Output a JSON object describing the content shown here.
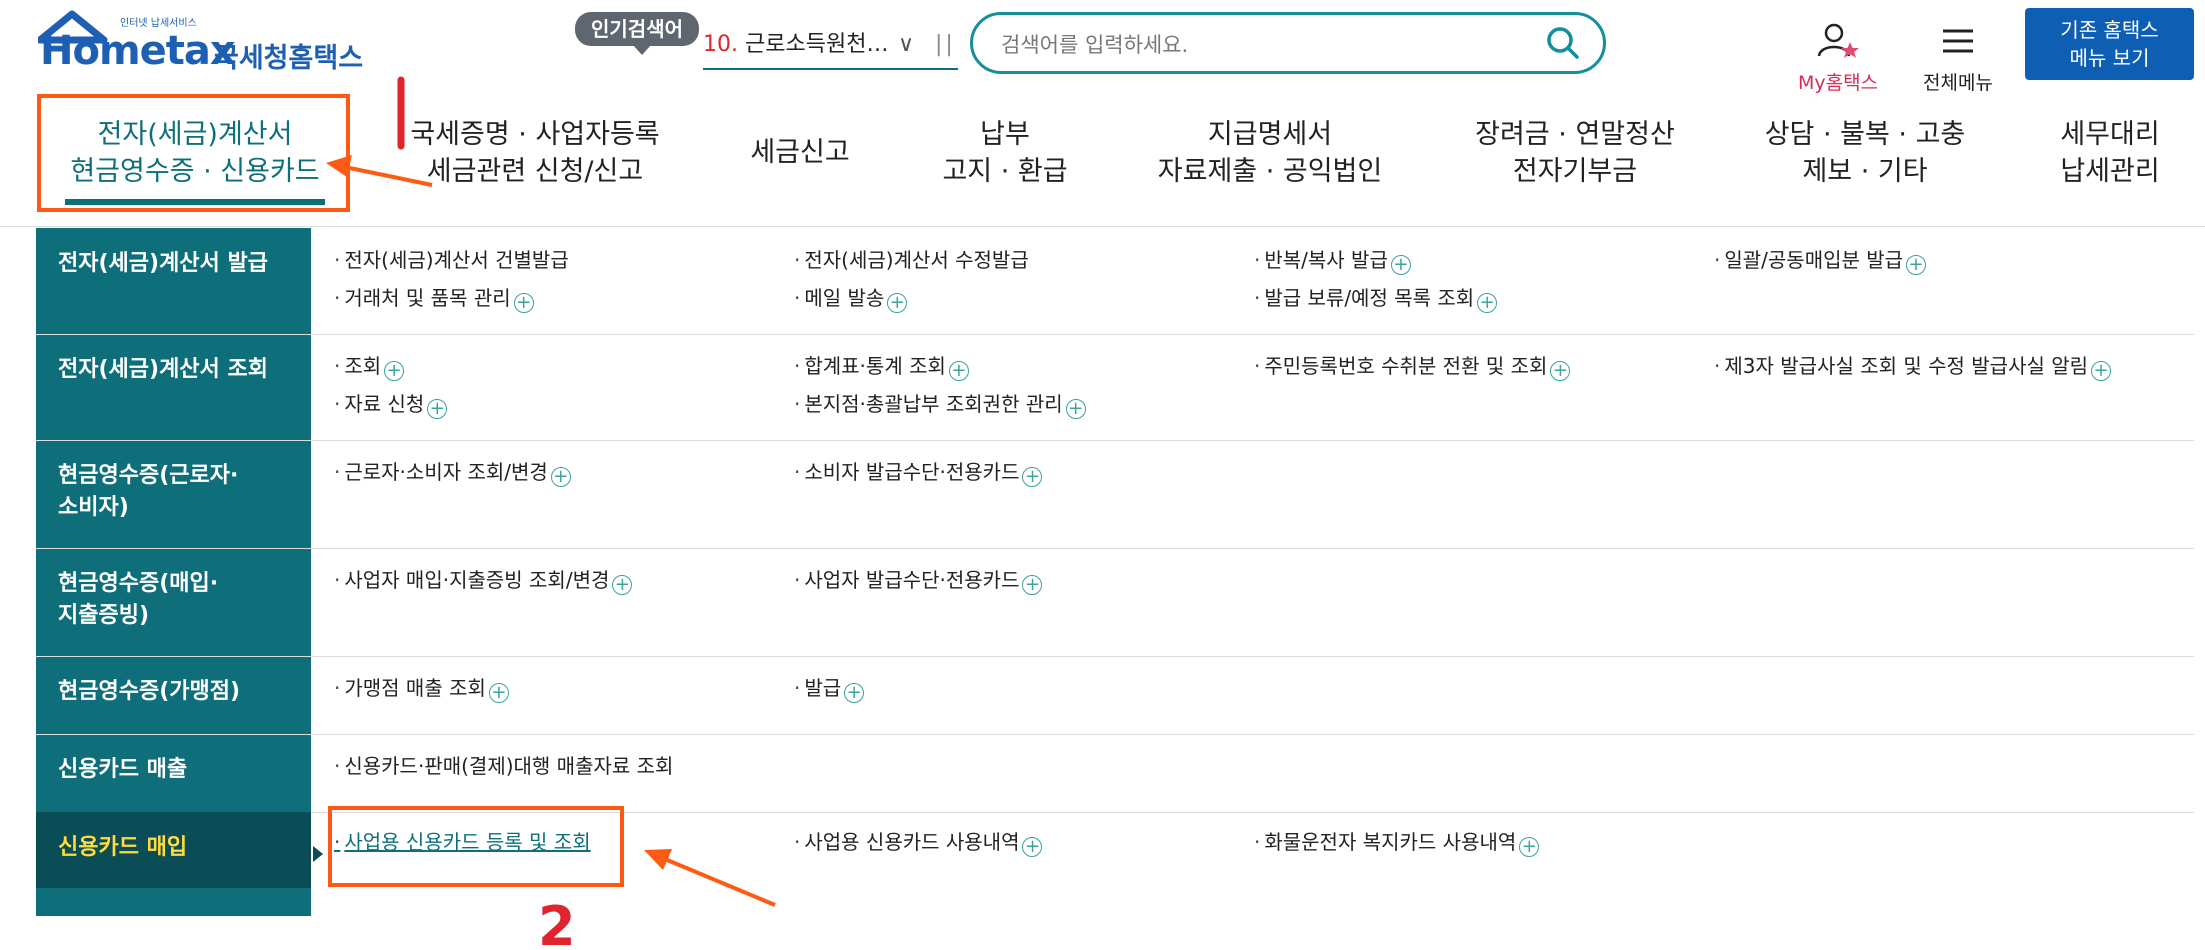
{
  "header": {
    "logo_text": "Hometax",
    "logo_sub": "인터넷 납세서비스",
    "logo_kor": "국세청홈택스",
    "popular_label": "인기검색어",
    "popular_rank": "10.",
    "popular_term": "근로소득원천…",
    "search_placeholder": "검색어를 입력하세요.",
    "my_label": "My홈택스",
    "allmenu_label": "전체메뉴",
    "old_btn_line1": "기존 홈택스",
    "old_btn_line2": "메뉴 보기"
  },
  "nav": [
    {
      "line1": "전자(세금)계산서",
      "line2": "현금영수증 · 신용카드"
    },
    {
      "line1": "국세증명 · 사업자등록",
      "line2": "세금관련 신청/신고"
    },
    {
      "line1": "세금신고",
      "line2": ""
    },
    {
      "line1": "납부",
      "line2": "고지 · 환급"
    },
    {
      "line1": "지급명세서",
      "line2": "자료제출 · 공익법인"
    },
    {
      "line1": "장려금 · 연말정산",
      "line2": "전자기부금"
    },
    {
      "line1": "상담 · 불복 · 고충",
      "line2": "제보 · 기타"
    },
    {
      "line1": "세무대리",
      "line2": "납세관리"
    }
  ],
  "menu": [
    {
      "label": "전자(세금)계산서 발급",
      "links": [
        "전자(세금)계산서 건별발급",
        "전자(세금)계산서 수정발급",
        "반복/복사 발급",
        "일괄/공동매입분 발급",
        "거래처 및 품목 관리",
        "메일 발송",
        "발급 보류/예정 목록 조회"
      ]
    },
    {
      "label": "전자(세금)계산서 조회",
      "links": [
        "조회",
        "합계표·통계 조회",
        "주민등록번호 수취분 전환 및 조회",
        "제3자 발급사실 조회 및 수정 발급사실 알림",
        "자료 신청",
        "본지점·총괄납부 조회권한 관리"
      ]
    },
    {
      "label_line1": "현금영수증(근로자·",
      "label_line2": "소비자)",
      "links": [
        "근로자·소비자 조회/변경",
        "소비자 발급수단·전용카드"
      ]
    },
    {
      "label_line1": "현금영수증(매입·",
      "label_line2": "지출증빙)",
      "links": [
        "사업자 매입·지출증빙 조회/변경",
        "사업자 발급수단·전용카드"
      ]
    },
    {
      "label": "현금영수증(가맹점)",
      "links": [
        "가맹점 매출 조회",
        "발급"
      ]
    },
    {
      "label": "신용카드 매출",
      "links": [
        "신용카드·판매(결제)대행 매출자료 조회"
      ]
    },
    {
      "label": "신용카드 매입",
      "links": [
        "사업용 신용카드 등록 및 조회",
        "사업용 신용카드 사용내역",
        "화물운전자 복지카드 사용내역"
      ]
    }
  ],
  "annotations": {
    "step2": "2"
  },
  "colors": {
    "teal": "#0e6f7a",
    "dark_teal": "#0a4d56",
    "annotation": "#ff5a14",
    "accent_red": "#e0242e",
    "blue_btn": "#0e5fb3"
  }
}
